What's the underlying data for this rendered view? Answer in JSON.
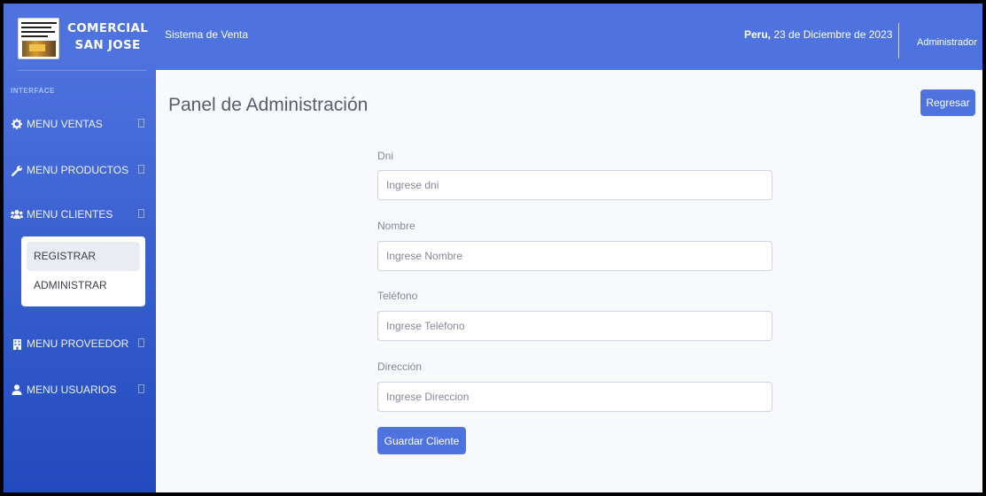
{
  "brand": {
    "line1": "COMERCIAL",
    "line2": "SAN JOSE"
  },
  "sidebar": {
    "heading": "INTERFACE",
    "items": [
      {
        "label": "MENU VENTAS",
        "icon": "cog-icon"
      },
      {
        "label": "MENU PRODUCTOS",
        "icon": "wrench-icon"
      },
      {
        "label": "MENU CLIENTES",
        "icon": "users-icon"
      },
      {
        "label": "MENU PROVEEDOR",
        "icon": "building-icon"
      },
      {
        "label": "MENU USUARIOS",
        "icon": "user-icon"
      }
    ],
    "submenu": [
      {
        "label": "REGISTRAR",
        "active": true
      },
      {
        "label": "ADMINISTRAR",
        "active": false
      }
    ]
  },
  "topbar": {
    "system_title": "Sistema de Venta",
    "country": "Peru,",
    "date": " 23 de Diciembre de 2023",
    "user": "Administrador"
  },
  "main": {
    "title": "Panel de Administración",
    "back_label": "Regresar",
    "form": {
      "dni": {
        "label": "Dni",
        "placeholder": "Ingrese dni",
        "value": ""
      },
      "nombre": {
        "label": "Nombre",
        "placeholder": "Ingrese Nombre",
        "value": ""
      },
      "telefono": {
        "label": "Teléfono",
        "placeholder": "Ingrese Teléfono",
        "value": ""
      },
      "direccion": {
        "label": "Dirección",
        "placeholder": "Ingrese Direccion",
        "value": ""
      },
      "submit_label": "Guardar Cliente"
    }
  },
  "colors": {
    "primary": "#4e73df",
    "sidebar_gradient_end": "#224abe",
    "background": "#f8f9fc"
  }
}
